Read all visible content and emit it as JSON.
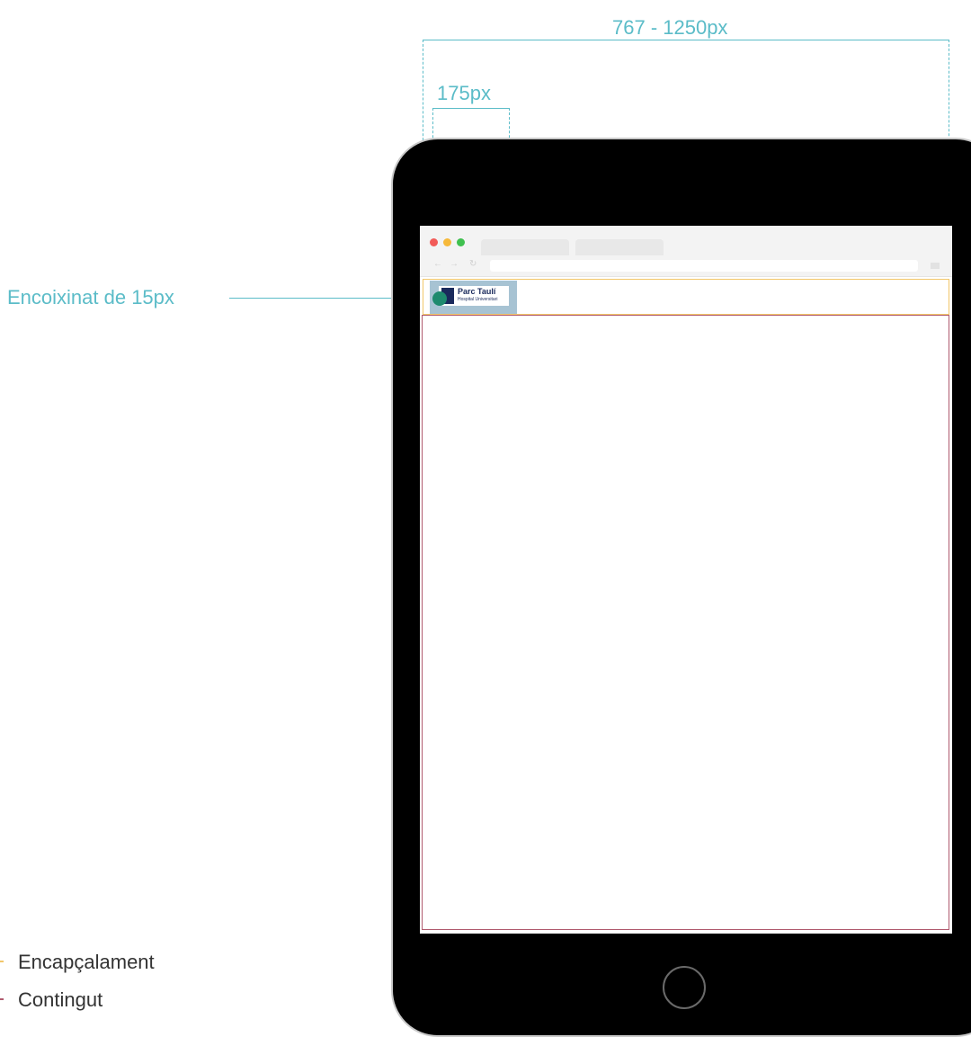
{
  "dimensions": {
    "viewport_range_label": "767 - 1250px",
    "logo_width_label": "175px",
    "padding_label": "Encoixinat de 15px"
  },
  "logo": {
    "name": "Parc Taulí",
    "subtitle": "Hospital Universitari"
  },
  "legend": [
    {
      "label": "Encapçalament",
      "color": "#f2c76a"
    },
    {
      "label": "Contingut",
      "color": "#b05a6e"
    }
  ],
  "colors": {
    "annotation": "#5bbcc8",
    "device": "#000000",
    "logo_background": "#a7c3d3",
    "logo_dot": "#1e8a6e"
  }
}
